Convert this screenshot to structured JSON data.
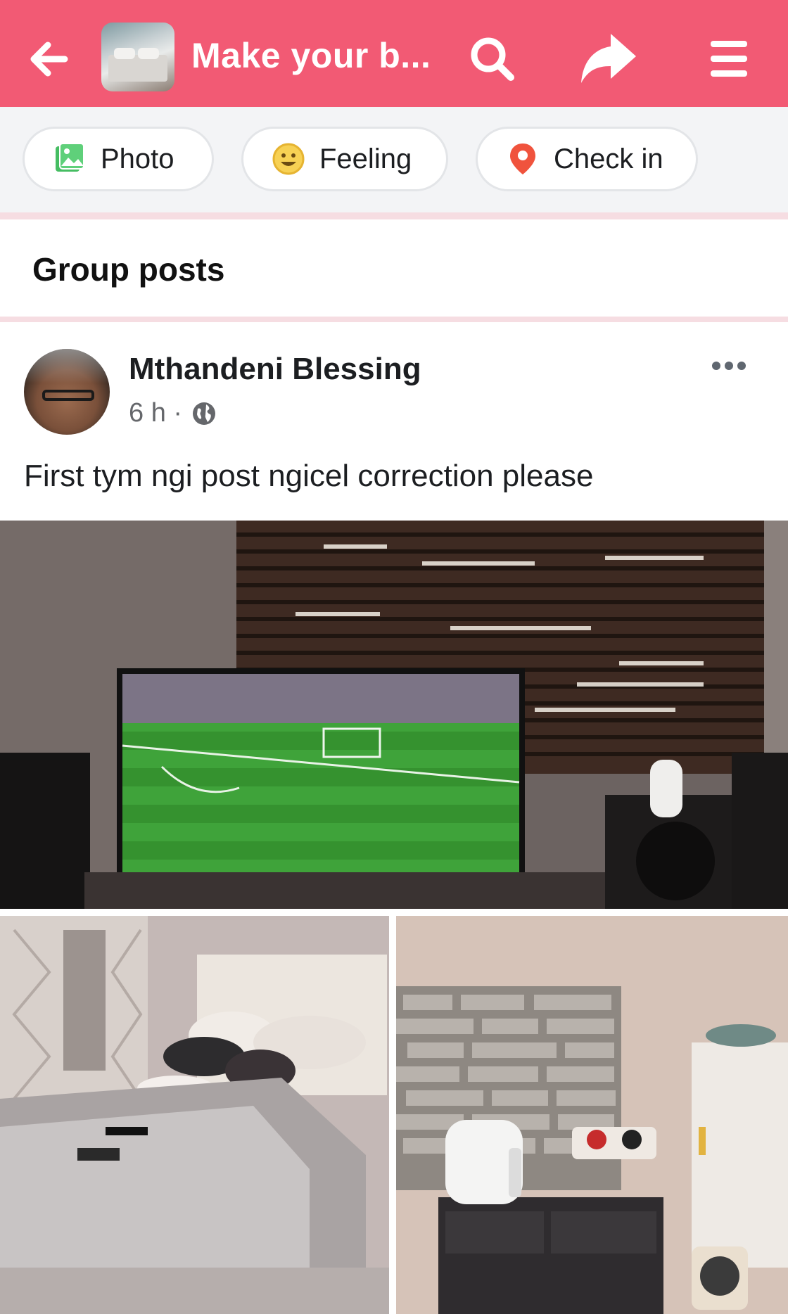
{
  "header": {
    "title": "Make your b...",
    "back_icon": "arrow-left-icon",
    "search_icon": "search-icon",
    "share_icon": "share-icon",
    "menu_icon": "hamburger-menu-icon",
    "background_color": "#f25a74"
  },
  "actions": [
    {
      "label": "Photo",
      "icon": "photo-icon"
    },
    {
      "label": "Feeling",
      "icon": "smiley-icon"
    },
    {
      "label": "Check in",
      "icon": "location-pin-icon"
    }
  ],
  "section": {
    "title": "Group posts"
  },
  "post": {
    "author": "Mthandeni Blessing",
    "time": "6 h ·",
    "privacy_icon": "globe-icon",
    "text": "First tym ngi post ngicel correction please",
    "photos": [
      "living-room-tv-photo",
      "bedroom-photo",
      "kitchen-corner-photo"
    ]
  }
}
